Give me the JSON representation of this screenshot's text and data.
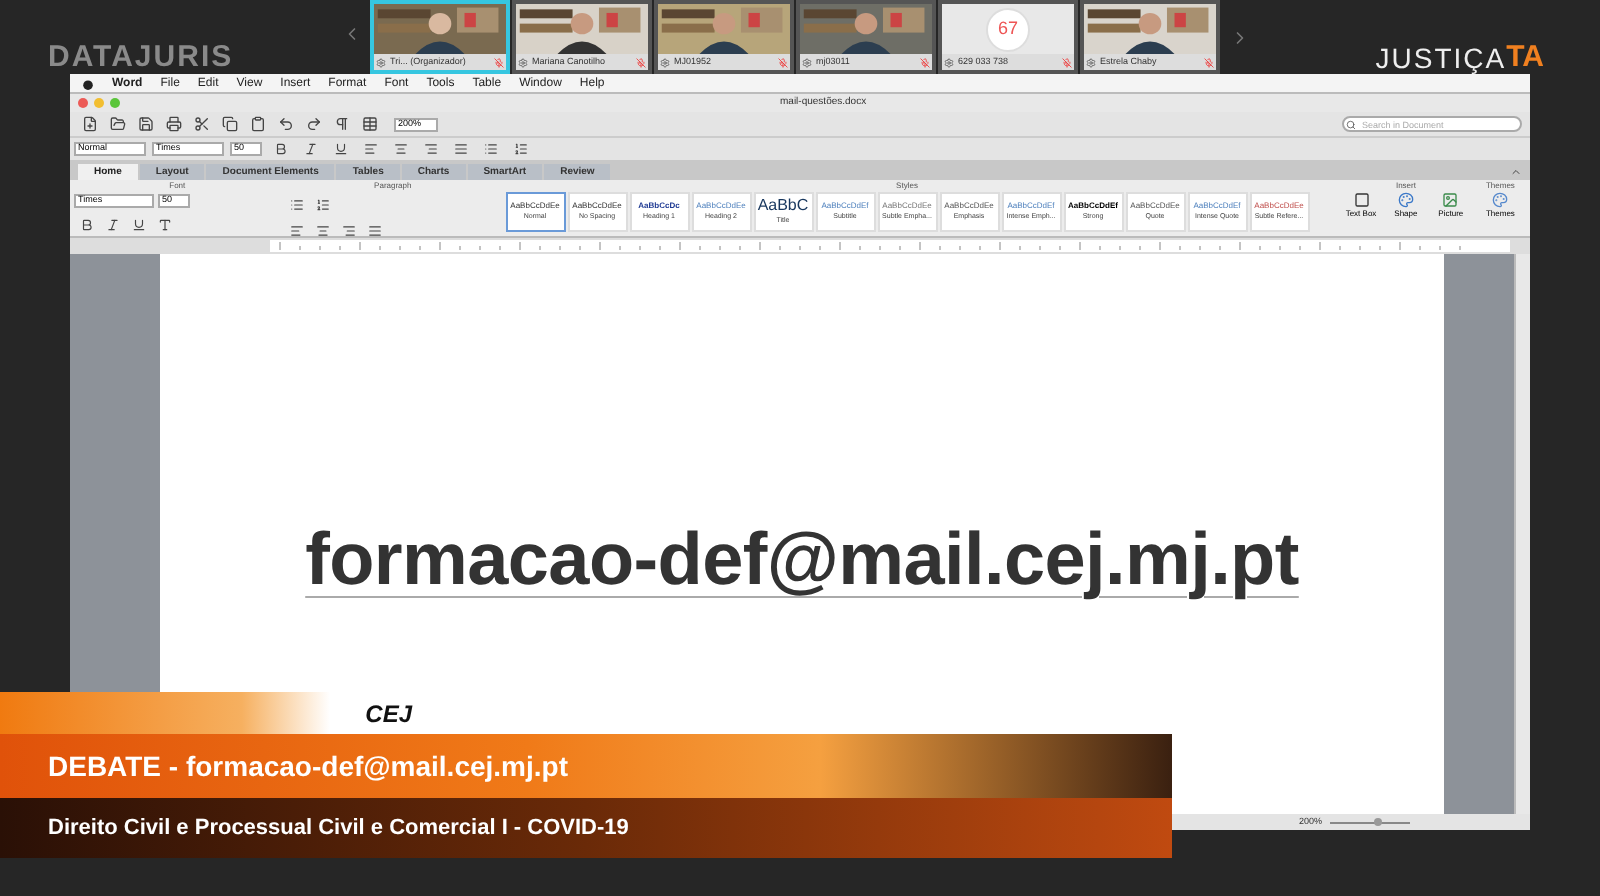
{
  "broadcast": {
    "brand": "DATAJURIS",
    "logo_text": "JUSTIÇA",
    "logo_mark": "TA"
  },
  "participants": [
    {
      "kind": "video",
      "name": "Tri... (Organizador)",
      "selected": true
    },
    {
      "kind": "video",
      "name": "Mariana Canotilho",
      "selected": false
    },
    {
      "kind": "video",
      "name": "MJ01952",
      "selected": false
    },
    {
      "kind": "video",
      "name": "mj03011",
      "selected": false
    },
    {
      "kind": "avatar",
      "avatar": "67",
      "name": "629 033 738",
      "selected": false
    },
    {
      "kind": "video",
      "name": "Estrela Chaby",
      "selected": false
    }
  ],
  "menu_bar": [
    "Word",
    "File",
    "Edit",
    "View",
    "Insert",
    "Format",
    "Font",
    "Tools",
    "Table",
    "Window",
    "Help"
  ],
  "document_title": "mail-questões.docx",
  "toolbar": {
    "zoom": "200%",
    "search_placeholder": "Search in Document"
  },
  "format_bar": {
    "style": "Normal",
    "font": "Times",
    "size": "50"
  },
  "ribbon": {
    "tabs": [
      {
        "label": "Home",
        "selected": true
      },
      {
        "label": "Layout",
        "selected": false
      },
      {
        "label": "Document Elements",
        "selected": false
      },
      {
        "label": "Tables",
        "selected": false
      },
      {
        "label": "Charts",
        "selected": false
      },
      {
        "label": "SmartArt",
        "selected": false
      },
      {
        "label": "Review",
        "selected": false
      }
    ],
    "groups": [
      "Font",
      "Paragraph",
      "Styles",
      "Insert",
      "Themes"
    ],
    "font": "Times",
    "size": "50",
    "styles": [
      {
        "sample": "AaBbCcDdEe",
        "name": "Normal",
        "selected": true
      },
      {
        "sample": "AaBbCcDdEe",
        "name": "No Spacing",
        "selected": false
      },
      {
        "sample": "AaBbCcDc",
        "name": "Heading 1",
        "selected": false
      },
      {
        "sample": "AaBbCcDdEe",
        "name": "Heading 2",
        "selected": false
      },
      {
        "sample": "AaBbC",
        "name": "Title",
        "selected": false
      },
      {
        "sample": "AaBbCcDdEf",
        "name": "Subtitle",
        "selected": false
      },
      {
        "sample": "AaBbCcDdEe",
        "name": "Subtle Empha...",
        "selected": false
      },
      {
        "sample": "AaBbCcDdEe",
        "name": "Emphasis",
        "selected": false
      },
      {
        "sample": "AaBbCcDdEf",
        "name": "Intense Emph...",
        "selected": false
      },
      {
        "sample": "AaBbCcDdEf",
        "name": "Strong",
        "selected": false
      },
      {
        "sample": "AaBbCcDdEe",
        "name": "Quote",
        "selected": false
      },
      {
        "sample": "AaBbCcDdEf",
        "name": "Intense Quote",
        "selected": false
      },
      {
        "sample": "AaBbCcDdEe",
        "name": "Subtle Refere...",
        "selected": false
      }
    ],
    "insert": [
      "Text Box",
      "Shape",
      "Picture"
    ],
    "themes": "Themes"
  },
  "document": {
    "text": "formacao-def@mail.cej.mj.pt"
  },
  "status_bar": {
    "zoom": "200%",
    "zoom_slider": {
      "level": 0.6
    }
  },
  "banner": {
    "org": "CEJ",
    "title": "DEBATE - formacao-def@mail.cej.mj.pt",
    "subtitle": "Direito Civil e Processual Civil e Comercial I - COVID-19"
  }
}
